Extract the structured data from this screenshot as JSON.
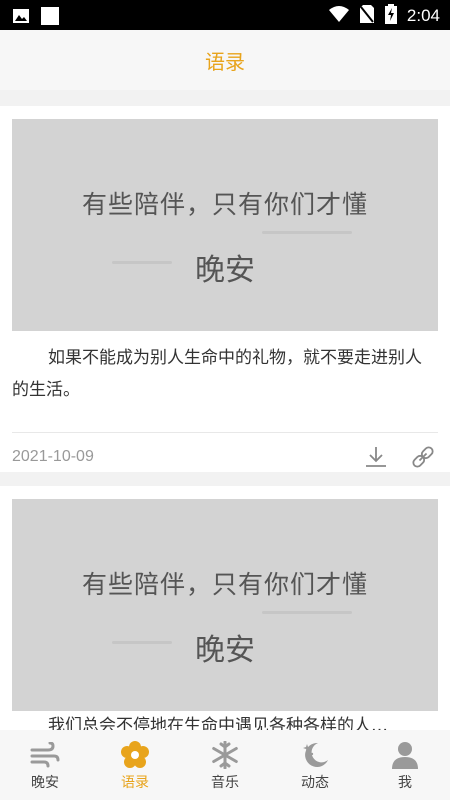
{
  "status_bar": {
    "time": "2:04"
  },
  "app_bar": {
    "title": "语录"
  },
  "feed": [
    {
      "image_text": {
        "line1": "有些陪伴，只有你们才懂",
        "line2": "晚安"
      },
      "quote": "如果不能成为别人生命中的礼物，就不要走进别人的生活。",
      "date": "2021-10-09"
    },
    {
      "image_text": {
        "line1": "有些陪伴，只有你们才懂",
        "line2": "晚安"
      },
      "quote": "我们总会不停地在生命中遇见各种各样的人…"
    }
  ],
  "tab_bar": {
    "items": [
      {
        "label": "晚安",
        "icon": "wind-icon"
      },
      {
        "label": "语录",
        "icon": "flower-icon",
        "active": true
      },
      {
        "label": "音乐",
        "icon": "snowflake-icon"
      },
      {
        "label": "动态",
        "icon": "moon-icon"
      },
      {
        "label": "我",
        "icon": "person-icon"
      }
    ]
  },
  "colors": {
    "accent": "#e8a41c",
    "icon_gray": "#9a9a9a"
  }
}
